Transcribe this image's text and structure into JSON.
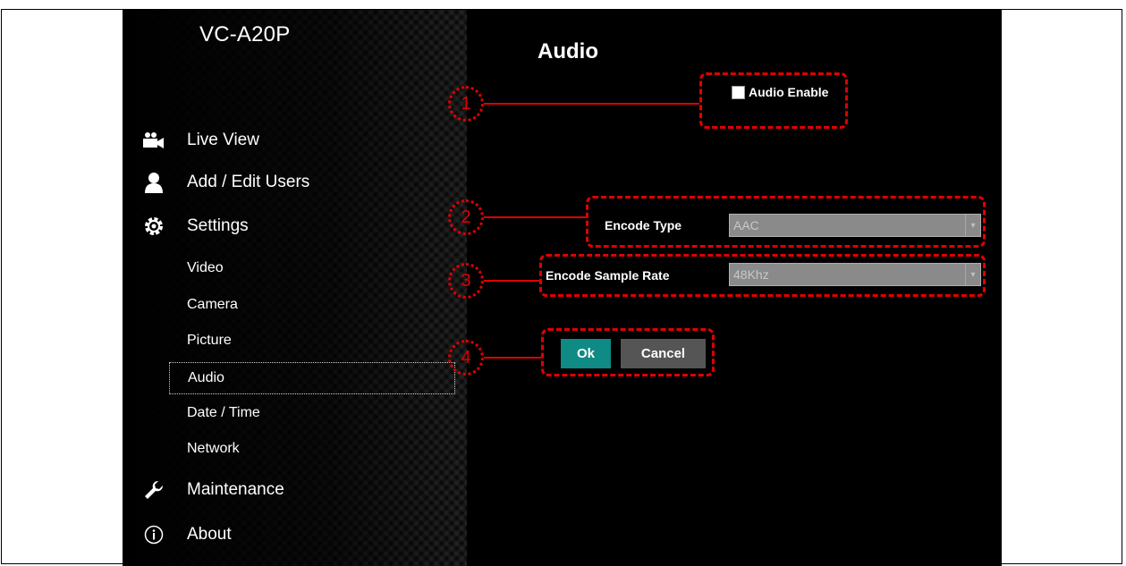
{
  "app": {
    "brand": "VC-A20P",
    "page_title": "Audio"
  },
  "nav": [
    {
      "id": "live-view",
      "label": "Live View",
      "icon": "video-camera-icon"
    },
    {
      "id": "add-edit-users",
      "label": "Add / Edit Users",
      "icon": "user-icon"
    },
    {
      "id": "settings",
      "label": "Settings",
      "icon": "gear-icon"
    },
    {
      "id": "maintenance",
      "label": "Maintenance",
      "icon": "wrench-icon"
    },
    {
      "id": "about",
      "label": "About",
      "icon": "info-icon"
    }
  ],
  "settings_sub": [
    {
      "label": "Video"
    },
    {
      "label": "Camera"
    },
    {
      "label": "Picture"
    },
    {
      "label": "Audio",
      "active": true
    },
    {
      "label": "Date / Time"
    },
    {
      "label": "Network"
    }
  ],
  "audio": {
    "enable_label": "Audio Enable",
    "enable_checked": false,
    "encode_type_label": "Encode Type",
    "encode_type_value": "AAC",
    "sample_rate_label": "Encode Sample Rate",
    "sample_rate_value": "48Khz"
  },
  "buttons": {
    "ok": "Ok",
    "cancel": "Cancel"
  },
  "callouts": [
    "1",
    "2",
    "3",
    "4"
  ],
  "colors": {
    "callout": "#e10000",
    "ok_button": "#0f8a84",
    "cancel_button": "#555555"
  }
}
